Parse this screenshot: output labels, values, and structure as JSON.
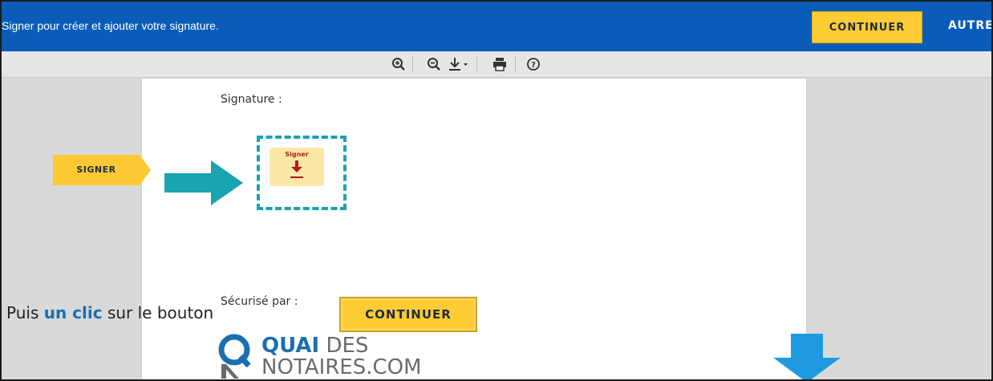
{
  "topbar": {
    "message": "Signer pour créer et ajouter votre signature.",
    "continue_label": "CONTINUER",
    "autre_label": "AUTRE"
  },
  "toolbar": {
    "icons": [
      "zoom-in-icon",
      "zoom-out-icon",
      "download-icon",
      "print-icon",
      "help-icon"
    ]
  },
  "document": {
    "signature_label": "Signature :",
    "secured_by_label": "Sécurisé par :",
    "sign_button_label": "Signer"
  },
  "annotations": {
    "signer_tag": "SIGNER",
    "instruction_prefix": "Puis ",
    "instruction_highlight": "un clic",
    "instruction_suffix": " sur le bouton",
    "continue_button_label": "CONTINUER"
  },
  "logo": {
    "word1": "QUAI",
    "word2": " DES",
    "word3": "NOTAIRES.COM"
  },
  "colors": {
    "topbar": "#0b5cb8",
    "accent_yellow": "#ffcc33",
    "teal": "#1aa3b0",
    "arrow_blue": "#1e9be0",
    "brand_blue": "#1a6fb0"
  }
}
